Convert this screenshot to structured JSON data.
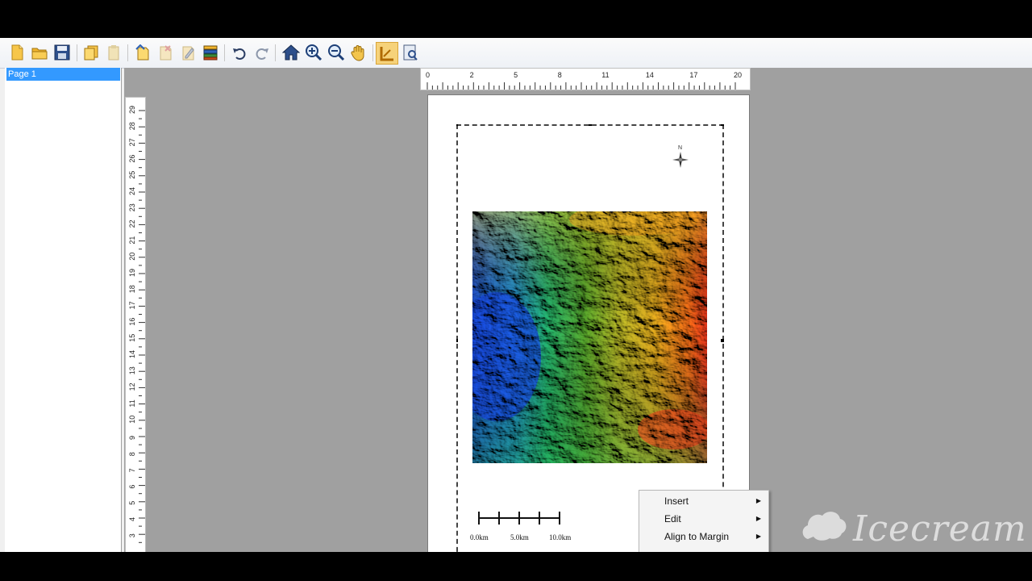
{
  "toolbar": {
    "buttons": [
      {
        "name": "new-layout-icon"
      },
      {
        "name": "open-folder-icon"
      },
      {
        "name": "save-icon"
      },
      {
        "name": "copy-icon"
      },
      {
        "name": "paste-icon"
      },
      {
        "name": "insert-element-icon"
      },
      {
        "name": "delete-element-icon"
      },
      {
        "name": "edit-element-icon"
      },
      {
        "name": "layers-icon"
      },
      {
        "name": "undo-icon"
      },
      {
        "name": "redo-icon"
      },
      {
        "name": "home-extent-icon"
      },
      {
        "name": "zoom-in-icon"
      },
      {
        "name": "zoom-out-icon"
      },
      {
        "name": "pan-hand-icon"
      },
      {
        "name": "select-tool-icon",
        "active": true
      },
      {
        "name": "page-setup-icon"
      }
    ]
  },
  "sidebar": {
    "pages": [
      "Page 1"
    ]
  },
  "rulers": {
    "horizontal_ticks": [
      "0",
      "2",
      "5",
      "8",
      "11",
      "14",
      "17",
      "20"
    ],
    "vertical_ticks": [
      "29",
      "28",
      "27",
      "26",
      "25",
      "24",
      "23",
      "22",
      "21",
      "20",
      "19",
      "18",
      "17",
      "16",
      "15",
      "14",
      "13",
      "12",
      "11",
      "10",
      "9",
      "8",
      "7",
      "6",
      "5",
      "4",
      "3"
    ]
  },
  "map": {
    "north_label": "N",
    "scale_labels": [
      "0.0km",
      "5.0km",
      "10.0km"
    ]
  },
  "context_menu": {
    "items": [
      {
        "label": "Insert"
      },
      {
        "label": "Edit"
      },
      {
        "label": "Align to Margin"
      }
    ]
  },
  "watermark": {
    "text": "Icecream"
  },
  "colors": {
    "accent": "#3399ff",
    "workspace": "#a0a0a0"
  }
}
